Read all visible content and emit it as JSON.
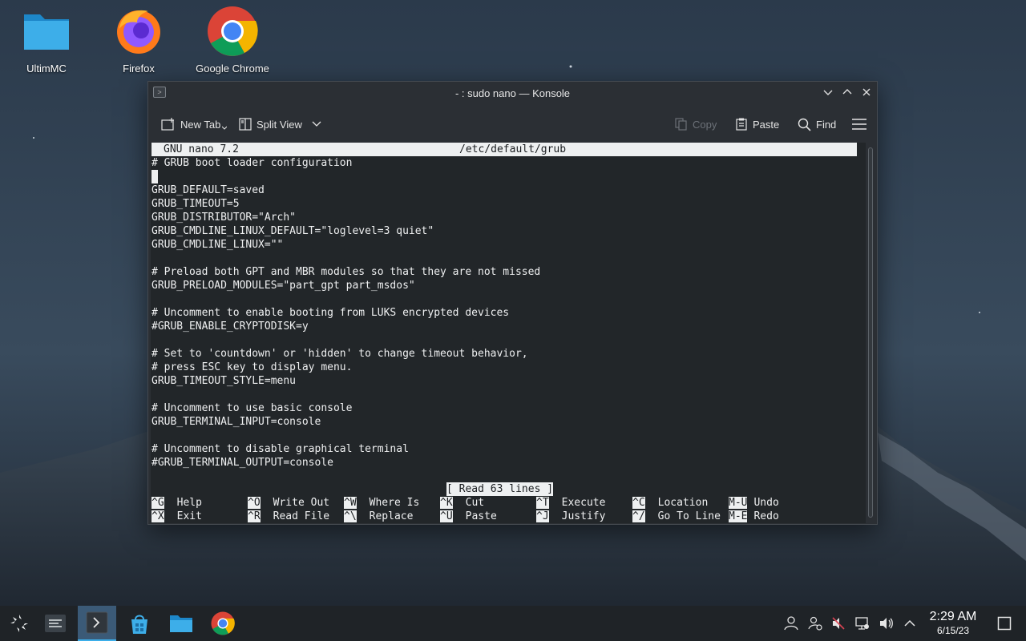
{
  "desktop": {
    "icons": [
      {
        "label": "UltimMC",
        "icon": "folder-icon"
      },
      {
        "label": "Firefox",
        "icon": "firefox-icon"
      },
      {
        "label": "Google Chrome",
        "icon": "chrome-icon"
      }
    ]
  },
  "window": {
    "title": "- : sudo nano — Konsole",
    "toolbar": {
      "new_tab": "New Tab",
      "split_view": "Split View",
      "copy": "Copy",
      "paste": "Paste",
      "find": "Find"
    }
  },
  "nano": {
    "version": "GNU nano 7.2",
    "filename": "/etc/default/grub",
    "lines": [
      "# GRUB boot loader configuration",
      "",
      "GRUB_DEFAULT=saved",
      "GRUB_TIMEOUT=5",
      "GRUB_DISTRIBUTOR=\"Arch\"",
      "GRUB_CMDLINE_LINUX_DEFAULT=\"loglevel=3 quiet\"",
      "GRUB_CMDLINE_LINUX=\"\"",
      "",
      "# Preload both GPT and MBR modules so that they are not missed",
      "GRUB_PRELOAD_MODULES=\"part_gpt part_msdos\"",
      "",
      "# Uncomment to enable booting from LUKS encrypted devices",
      "#GRUB_ENABLE_CRYPTODISK=y",
      "",
      "# Set to 'countdown' or 'hidden' to change timeout behavior,",
      "# press ESC key to display menu.",
      "GRUB_TIMEOUT_STYLE=menu",
      "",
      "# Uncomment to use basic console",
      "GRUB_TERMINAL_INPUT=console",
      "",
      "# Uncomment to disable graphical terminal",
      "#GRUB_TERMINAL_OUTPUT=console"
    ],
    "status": "[ Read 63 lines ]",
    "shortcuts_row1": [
      {
        "key": "^G",
        "label": "Help"
      },
      {
        "key": "^O",
        "label": "Write Out"
      },
      {
        "key": "^W",
        "label": "Where Is"
      },
      {
        "key": "^K",
        "label": "Cut"
      },
      {
        "key": "^T",
        "label": "Execute"
      },
      {
        "key": "^C",
        "label": "Location"
      },
      {
        "key": "M-U",
        "label": "Undo"
      }
    ],
    "shortcuts_row2": [
      {
        "key": "^X",
        "label": "Exit"
      },
      {
        "key": "^R",
        "label": "Read File"
      },
      {
        "key": "^\\",
        "label": "Replace"
      },
      {
        "key": "^U",
        "label": "Paste"
      },
      {
        "key": "^J",
        "label": "Justify"
      },
      {
        "key": "^/",
        "label": "Go To Line"
      },
      {
        "key": "M-E",
        "label": "Redo"
      }
    ]
  },
  "taskbar": {
    "time": "2:29 AM",
    "date": "6/15/23"
  }
}
